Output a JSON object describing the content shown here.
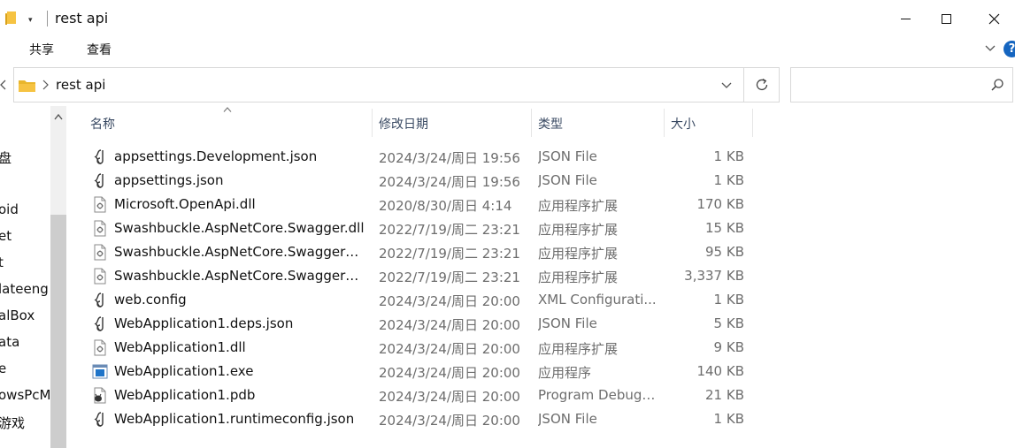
{
  "window": {
    "title": "rest api",
    "qa_dropdown_glyph": "▾"
  },
  "ribbon": {
    "tabs": [
      {
        "label": "共享"
      },
      {
        "label": "查看"
      }
    ],
    "help_glyph": "?"
  },
  "address": {
    "path": "rest api"
  },
  "search": {
    "value": "",
    "placeholder": ""
  },
  "nav": {
    "items": [
      "盘",
      "oid",
      "et",
      "t",
      "lateeng",
      "alBox",
      "ata",
      "e",
      "owsPcM",
      "游戏"
    ]
  },
  "columns": {
    "name": "名称",
    "modified": "修改日期",
    "type": "类型",
    "size": "大小"
  },
  "files": [
    {
      "icon": "json-file-icon",
      "name": "appsettings.Development.json",
      "modified": "2024/3/24/周日 19:56",
      "type": "JSON File",
      "size": "1 KB"
    },
    {
      "icon": "json-file-icon",
      "name": "appsettings.json",
      "modified": "2024/3/24/周日 19:56",
      "type": "JSON File",
      "size": "1 KB"
    },
    {
      "icon": "dll-file-icon",
      "name": "Microsoft.OpenApi.dll",
      "modified": "2020/8/30/周日 4:14",
      "type": "应用程序扩展",
      "size": "170 KB"
    },
    {
      "icon": "dll-file-icon",
      "name": "Swashbuckle.AspNetCore.Swagger.dll",
      "modified": "2022/7/19/周二 23:21",
      "type": "应用程序扩展",
      "size": "15 KB"
    },
    {
      "icon": "dll-file-icon",
      "name": "Swashbuckle.AspNetCore.SwaggerG...",
      "modified": "2022/7/19/周二 23:21",
      "type": "应用程序扩展",
      "size": "95 KB"
    },
    {
      "icon": "dll-file-icon",
      "name": "Swashbuckle.AspNetCore.SwaggerUI...",
      "modified": "2022/7/19/周二 23:21",
      "type": "应用程序扩展",
      "size": "3,337 KB"
    },
    {
      "icon": "config-file-icon",
      "name": "web.config",
      "modified": "2024/3/24/周日 20:00",
      "type": "XML Configurati...",
      "size": "1 KB"
    },
    {
      "icon": "json-file-icon",
      "name": "WebApplication1.deps.json",
      "modified": "2024/3/24/周日 20:00",
      "type": "JSON File",
      "size": "5 KB"
    },
    {
      "icon": "dll-file-icon",
      "name": "WebApplication1.dll",
      "modified": "2024/3/24/周日 20:00",
      "type": "应用程序扩展",
      "size": "9 KB"
    },
    {
      "icon": "exe-file-icon",
      "name": "WebApplication1.exe",
      "modified": "2024/3/24/周日 20:00",
      "type": "应用程序",
      "size": "140 KB"
    },
    {
      "icon": "pdb-file-icon",
      "name": "WebApplication1.pdb",
      "modified": "2024/3/24/周日 20:00",
      "type": "Program Debug ...",
      "size": "21 KB"
    },
    {
      "icon": "json-file-icon",
      "name": "WebApplication1.runtimeconfig.json",
      "modified": "2024/3/24/周日 20:00",
      "type": "JSON File",
      "size": "1 KB"
    }
  ],
  "colors": {
    "folder_yellow": "#f6c342",
    "help_blue": "#1565c0",
    "header_text": "#3a4a63",
    "secondary_text": "#6d6d6d",
    "exe_blue": "#1e74c9"
  }
}
